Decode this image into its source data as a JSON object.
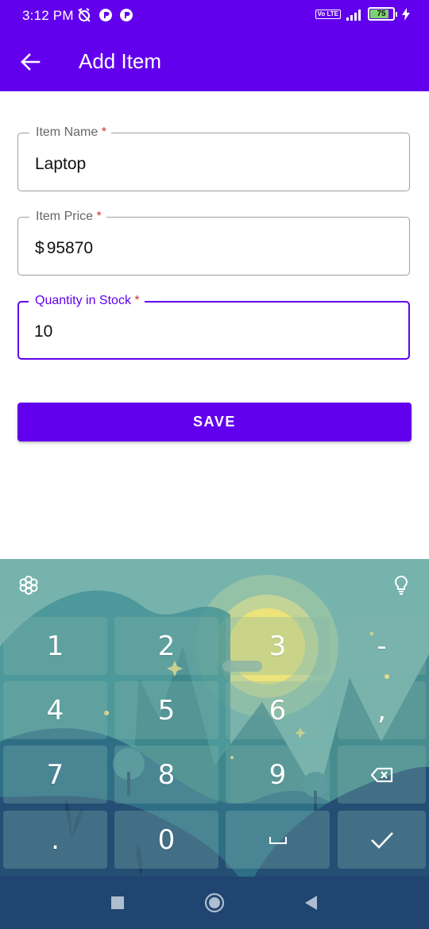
{
  "status_bar": {
    "time": "3:12 PM",
    "battery_level": "75",
    "network_label": "Vo LTE"
  },
  "app_bar": {
    "title": "Add Item",
    "back_icon": "arrow-back-icon"
  },
  "form": {
    "item_name": {
      "label": "Item Name",
      "required_mark": "*",
      "value": "Laptop"
    },
    "item_price": {
      "label": "Item Price",
      "required_mark": "*",
      "prefix": "$",
      "value": "95870"
    },
    "quantity": {
      "label": "Quantity in Stock",
      "required_mark": "*",
      "value": "10"
    },
    "save_label": "SAVE"
  },
  "keyboard": {
    "toolbar_left_icon": "settings-flower-icon",
    "toolbar_right_icon": "lightbulb-icon",
    "keys": {
      "k1": "1",
      "k2": "2",
      "k3": "3",
      "k_minus": "-",
      "k4": "4",
      "k5": "5",
      "k6": "6",
      "k_comma": ",",
      "k7": "7",
      "k8": "8",
      "k9": "9",
      "k_dot": ".",
      "k0": "0"
    },
    "backspace_icon": "backspace-icon",
    "space_icon": "space-icon",
    "done_icon": "checkmark-icon"
  },
  "nav_bar": {
    "recents_icon": "square-recents-icon",
    "home_icon": "circle-home-icon",
    "back_icon": "triangle-back-icon"
  },
  "colors": {
    "primary": "#6200ee",
    "required": "#d32f2f",
    "nav_bar": "#1f4570"
  }
}
